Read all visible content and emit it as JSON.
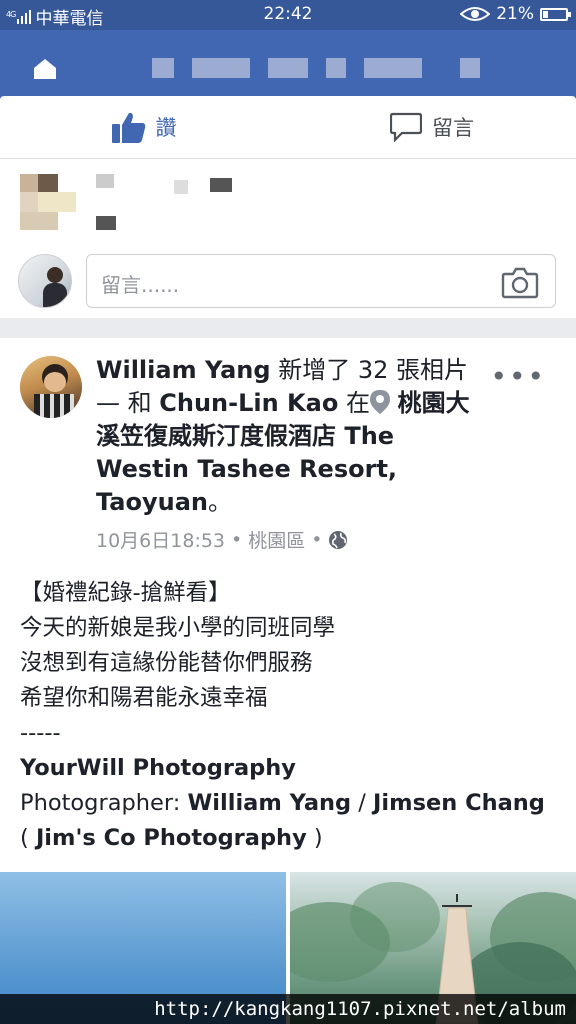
{
  "status_bar": {
    "signal": "4G",
    "carrier": "中華電信",
    "time": "22:42",
    "battery": "21%"
  },
  "actions": {
    "like_label": "讚",
    "comment_label": "留言"
  },
  "comment_box": {
    "placeholder": "留言......"
  },
  "post": {
    "author": "William Yang",
    "added_text": " 新增了 32 張相片 — 和 ",
    "tagged": "Chun-Lin Kao",
    "at_text": " 在",
    "location": "桃園大溪笠復威斯汀度假酒店 The Westin Tashee Resort, Taoyuan",
    "end_punct": "。",
    "date": "10月6日18:53",
    "place": "桃園區",
    "separator": "•",
    "body": {
      "line1": "【婚禮紀錄-搶鮮看】",
      "line2": "今天的新娘是我小學的同班同學",
      "line3": "沒想到有這緣份能替你們服務",
      "line4": "希望你和陽君能永遠幸福",
      "line5": "-----",
      "brand": "YourWill Photography",
      "photographer_label": "Photographer: ",
      "photographer1": "William Yang",
      "slash": " / ",
      "photographer2": "Jimsen Chang",
      "paren_open": " ( ",
      "studio": "Jim's Co Photography",
      "paren_close": " )"
    }
  },
  "watermark": "http://kangkang1107.pixnet.net/album",
  "colors": {
    "header": "#4267b2",
    "status_bar": "#365899",
    "link": "#4267b2",
    "meta_gray": "#90949c"
  }
}
